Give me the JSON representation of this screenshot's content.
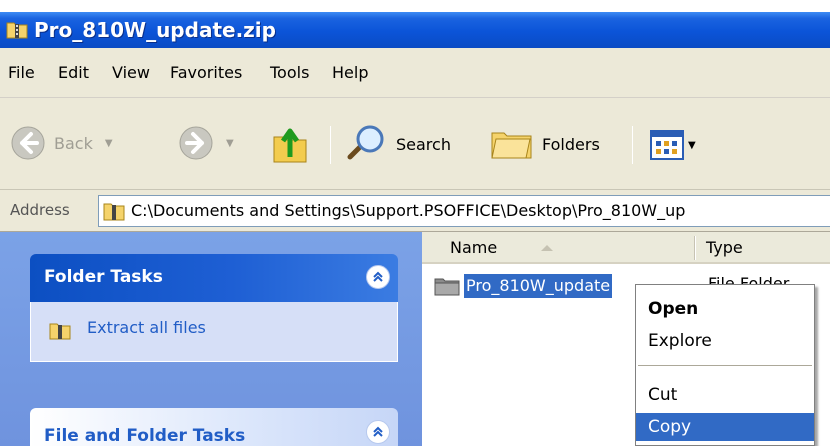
{
  "window": {
    "title": "Pro_810W_update.zip",
    "title_icon": "zip-folder-icon"
  },
  "menu": [
    {
      "label": "File"
    },
    {
      "label": "Edit"
    },
    {
      "label": "View"
    },
    {
      "label": "Favorites"
    },
    {
      "label": "Tools"
    },
    {
      "label": "Help"
    }
  ],
  "toolbar": {
    "back_label": "Back",
    "search_label": "Search",
    "folders_label": "Folders"
  },
  "address": {
    "label": "Address",
    "value": "C:\\Documents and Settings\\Support.PSOFFICE\\Desktop\\Pro_810W_up"
  },
  "folder_tasks": {
    "title": "Folder Tasks",
    "items": [
      {
        "label": "Extract all files"
      }
    ]
  },
  "file_folder_tasks": {
    "title": "File and Folder Tasks"
  },
  "file_list": {
    "columns": [
      "Name",
      "Type"
    ],
    "rows": [
      {
        "name": "Pro_810W_update",
        "type": "File Folder"
      }
    ]
  },
  "context_menu": {
    "items": [
      {
        "label": "Open",
        "default": true
      },
      {
        "label": "Explore"
      },
      {
        "label": "Cut"
      },
      {
        "label": "Copy",
        "highlighted": true
      }
    ]
  },
  "colors": {
    "title_blue": "#0b54d8",
    "selection": "#316ac5",
    "chrome": "#ece9d8",
    "task_pane": "#7ba2e7"
  }
}
